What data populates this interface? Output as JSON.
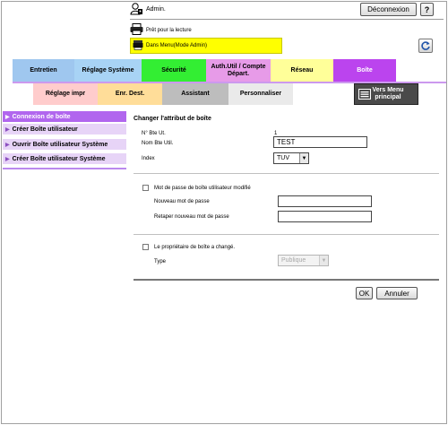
{
  "header": {
    "admin_label": "Admin.",
    "logout_label": "Déconnexion",
    "help_label": "?",
    "status_text": "Prêt pour la lecture",
    "mode_text": "Dans Menu(Mode Admin)"
  },
  "tabs": [
    {
      "label": "Entretien"
    },
    {
      "label": "Réglage Système"
    },
    {
      "label": "Sécurité"
    },
    {
      "label": "Auth.Util / Compte Départ."
    },
    {
      "label": "Réseau"
    },
    {
      "label": "Boîte"
    }
  ],
  "subtabs": [
    {
      "label": "Réglage impr"
    },
    {
      "label": "Enr. Dest."
    },
    {
      "label": "Assistant"
    },
    {
      "label": "Personnaliser"
    }
  ],
  "menu_button": {
    "label": "Vers Menu principal"
  },
  "sidebar": {
    "items": [
      {
        "label": "Connexion de boîte"
      },
      {
        "label": "Créer Boîte utilisateur"
      },
      {
        "label": "Ouvrir Boîte utilisateur Système"
      },
      {
        "label": "Créer Boîte utilisateur Système"
      }
    ]
  },
  "form": {
    "title": "Changer l'attribut de boîte",
    "box_number_label": "N° Bte Ut.",
    "box_number_value": "1",
    "box_name_label": "Nom Bte Util.",
    "box_name_value": "TEST",
    "index_label": "Index",
    "index_value": "TUV",
    "password_changed_label": "Mot de passe de boîte utilisateur modifié",
    "new_password_label": "Nouveau mot de passe",
    "retype_password_label": "Retaper nouveau mot de passe",
    "owner_changed_label": "Le propriétaire de boîte a changé.",
    "type_label": "Type",
    "type_value": "Publique",
    "ok_label": "OK",
    "cancel_label": "Annuler"
  },
  "colors": {
    "mode_bar": "#ffff00",
    "sidebar_active": "#b166ee",
    "tab_box": "#bb44ee"
  }
}
